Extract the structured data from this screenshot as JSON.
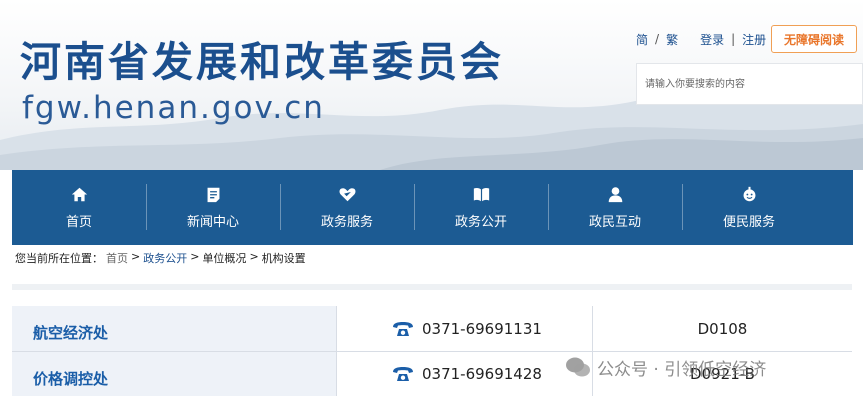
{
  "header": {
    "title": "河南省发展和改革委员会",
    "domain": "fgw.henan.gov.cn",
    "lang_simplified": "简",
    "lang_separator": "/",
    "lang_traditional": "繁",
    "login": "登录",
    "link_separator": "|",
    "register": "注册",
    "accessibility_button": "无障碍阅读",
    "search_placeholder": "请输入你要搜索的内容"
  },
  "nav": {
    "items": [
      {
        "label": "首页",
        "icon": "home-icon"
      },
      {
        "label": "新闻中心",
        "icon": "news-icon"
      },
      {
        "label": "政务服务",
        "icon": "handshake-icon"
      },
      {
        "label": "政务公开",
        "icon": "book-icon"
      },
      {
        "label": "政民互动",
        "icon": "person-icon"
      },
      {
        "label": "便民服务",
        "icon": "service-icon"
      }
    ]
  },
  "breadcrumb": {
    "prefix": "您当前所在位置：",
    "items": [
      "首页",
      "政务公开",
      "单位概况",
      "机构设置"
    ],
    "separator": ">"
  },
  "table": {
    "rows": [
      {
        "name": "航空经济处",
        "phone": "0371-69691131",
        "code": "D0108"
      },
      {
        "name": "价格调控处",
        "phone": "0371-69691428",
        "code": "D0921-B"
      }
    ]
  },
  "watermark": {
    "text": "公众号 · 引领低空经济"
  },
  "colors": {
    "nav_bg": "#1c5b93",
    "title": "#1b4f8e",
    "accent_orange": "#e9762b",
    "row_bg": "#eef2f8"
  }
}
